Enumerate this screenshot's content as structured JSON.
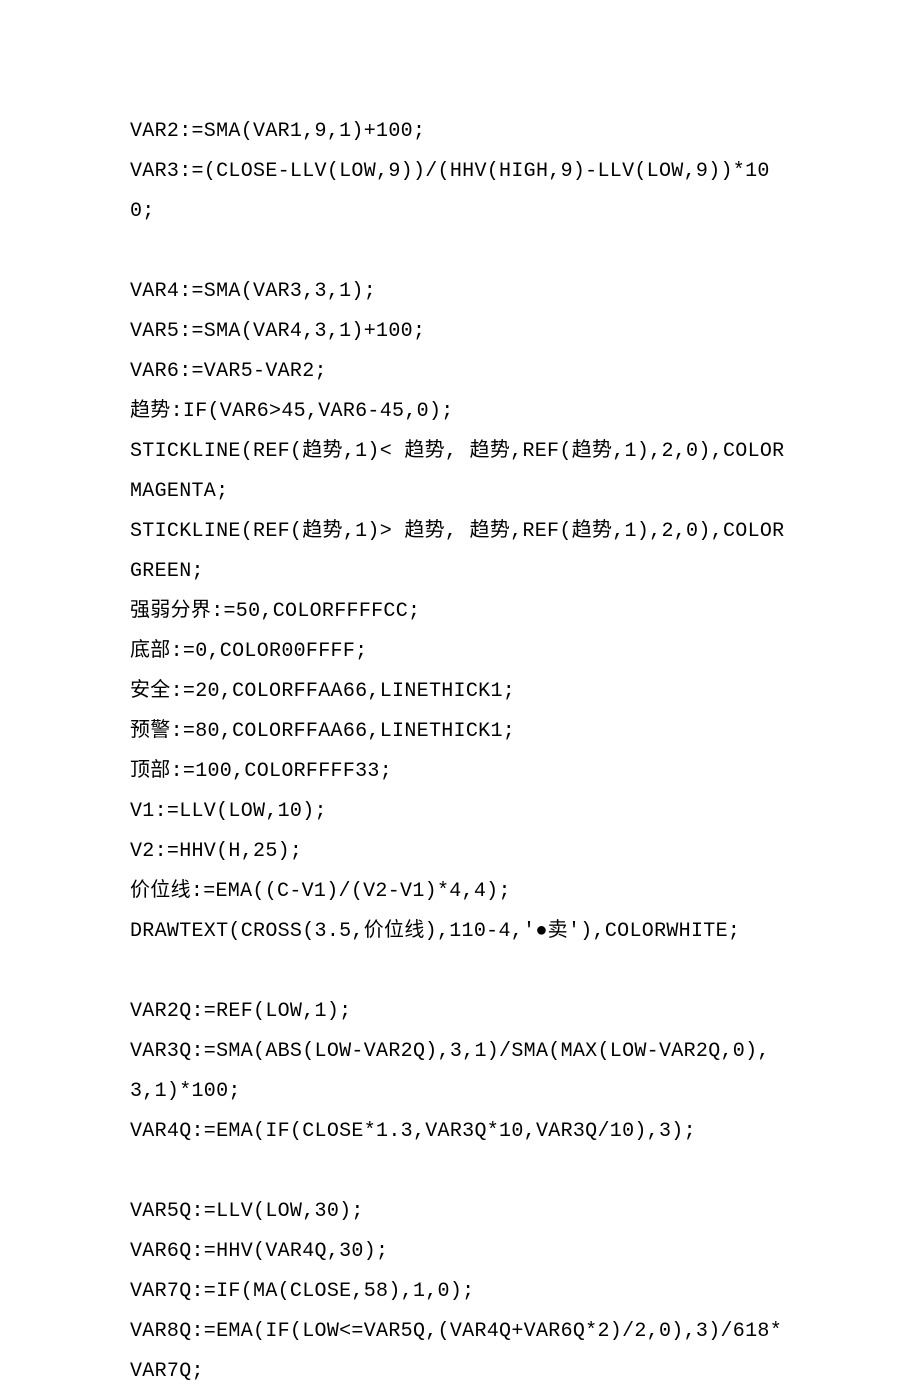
{
  "lines": [
    "VAR2:=SMA(VAR1,9,1)+100;",
    "VAR3:=(CLOSE-LLV(LOW,9))/(HHV(HIGH,9)-LLV(LOW,9))*100;",
    "",
    "VAR4:=SMA(VAR3,3,1);",
    "VAR5:=SMA(VAR4,3,1)+100;",
    "VAR6:=VAR5-VAR2;",
    "趋势:IF(VAR6>45,VAR6-45,0);",
    "STICKLINE(REF(趋势,1)< 趋势, 趋势,REF(趋势,1),2,0),COLORMAGENTA;",
    "STICKLINE(REF(趋势,1)> 趋势, 趋势,REF(趋势,1),2,0),COLORGREEN;",
    "强弱分界:=50,COLORFFFFCC;",
    "底部:=0,COLOR00FFFF;",
    "安全:=20,COLORFFAA66,LINETHICK1;",
    "预警:=80,COLORFFAA66,LINETHICK1;",
    "顶部:=100,COLORFFFF33;",
    "V1:=LLV(LOW,10);",
    "V2:=HHV(H,25);",
    "价位线:=EMA((C-V1)/(V2-V1)*4,4);",
    "DRAWTEXT(CROSS(3.5,价位线),110-4,'●卖'),COLORWHITE;",
    "",
    "VAR2Q:=REF(LOW,1);",
    "VAR3Q:=SMA(ABS(LOW-VAR2Q),3,1)/SMA(MAX(LOW-VAR2Q,0),3,1)*100;",
    "VAR4Q:=EMA(IF(CLOSE*1.3,VAR3Q*10,VAR3Q/10),3);",
    "",
    "VAR5Q:=LLV(LOW,30);",
    "VAR6Q:=HHV(VAR4Q,30);",
    "VAR7Q:=IF(MA(CLOSE,58),1,0);",
    "VAR8Q:=EMA(IF(LOW<=VAR5Q,(VAR4Q+VAR6Q*2)/2,0),3)/618*VAR7Q;"
  ]
}
